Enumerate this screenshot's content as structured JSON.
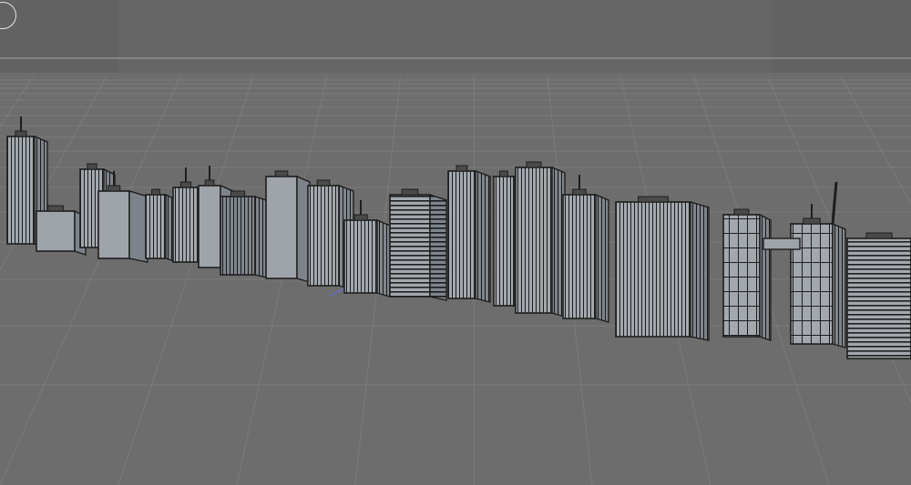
{
  "viewport": {
    "background_color": "#6d6d6d",
    "sky_color": "#666666",
    "grid_color": "#8a8a8a",
    "horizon_line_color": "#d0d0d0",
    "building_face_color": "#9ea4aa",
    "building_side_color": "#7d838a",
    "building_edge_color": "#1e1e1e"
  },
  "icons": {
    "view_cube": "circle-icon"
  }
}
